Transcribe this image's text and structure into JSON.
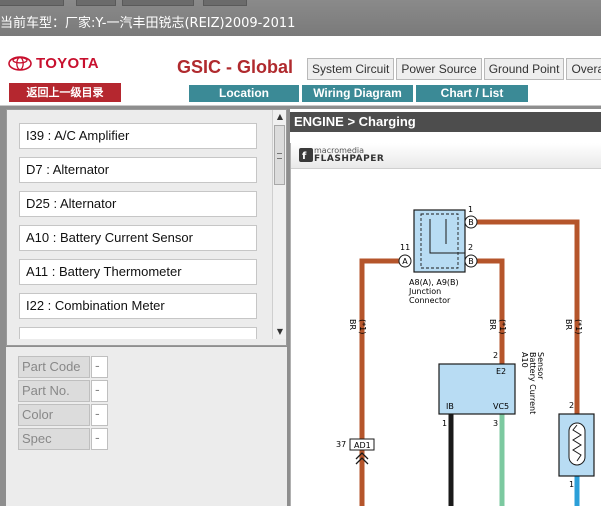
{
  "window": {
    "title": "当前车型：厂家:Y-一汽丰田锐志(REIZ)2009-2011"
  },
  "header": {
    "logo_text": "TOYOTA",
    "back_label": "返回上一级目录",
    "brand": "GSIC - Global",
    "top_tabs": [
      "System Circuit",
      "Power Source",
      "Ground Point",
      "Overa"
    ],
    "teal_tabs": [
      "Location",
      "Wiring Diagram",
      "Chart / List"
    ]
  },
  "list": {
    "items": [
      "I39 : A/C Amplifier",
      "D7 : Alternator",
      "D25 : Alternator",
      "A10 : Battery Current Sensor",
      "A11 : Battery Thermometer",
      "I22 : Combination Meter",
      ""
    ]
  },
  "properties": [
    {
      "label": "Part Code",
      "value": "-"
    },
    {
      "label": "Part No.",
      "value": "-"
    },
    {
      "label": "Color",
      "value": "-"
    },
    {
      "label": "Spec",
      "value": "-"
    }
  ],
  "main": {
    "breadcrumb": "ENGINE > Charging",
    "flash_line1": "macromedia",
    "flash_line2": "FLASHPAPER"
  },
  "diagram": {
    "jc_label1": "A8(A), A9(B)",
    "jc_label2": "Junction",
    "jc_label3": "Connector",
    "pin_11": "11",
    "pin_1": "1",
    "pin_2": "2",
    "pin_A": "A",
    "pin_B1": "B",
    "pin_B2": "B",
    "wire_br_1": "BR",
    "wire_star_1": "(*1)",
    "wire_br_2": "BR",
    "wire_star_2": "(*1)",
    "wire_br_3": "BR",
    "wire_star_3": "(*1)",
    "sensor_pin_2": "2",
    "sensor_e2": "E2",
    "sensor_ib": "IB",
    "sensor_vc5": "VC5",
    "sensor_pin_1": "1",
    "sensor_pin_3": "3",
    "sensor_code": "A10",
    "sensor_name1": "Battery Current",
    "sensor_name2": "Sensor",
    "ad_num": "37",
    "ad_label": "AD1",
    "therm_pin_2": "2",
    "therm_pin_1": "1",
    "colors": {
      "wire_br": "#b5552b",
      "wire_black": "#1a1a1a",
      "wire_green": "#7cc9a0",
      "wire_blue": "#2b9fd8",
      "component": "#b8dcf3"
    }
  }
}
